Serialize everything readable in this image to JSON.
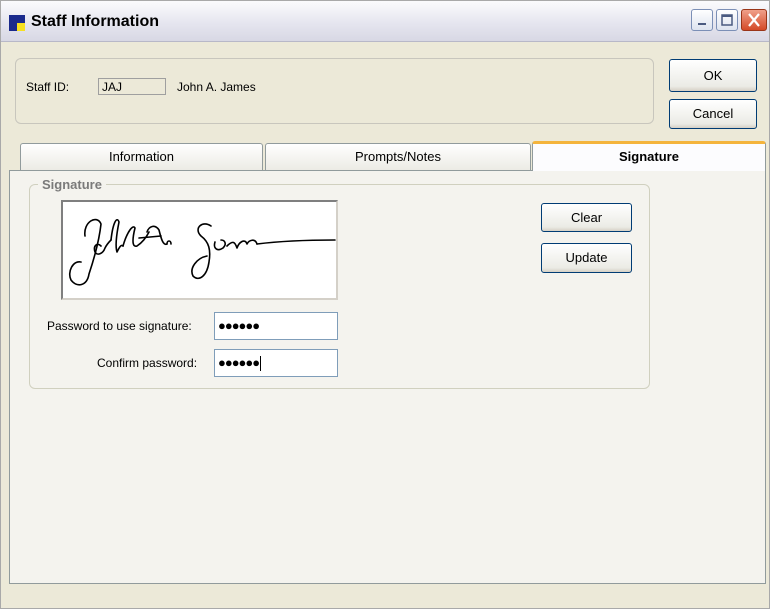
{
  "window": {
    "title": "Staff Information"
  },
  "header": {
    "staff_id_label": "Staff ID:",
    "staff_id_value": "JAJ",
    "staff_name": "John A. James"
  },
  "buttons": {
    "ok": "OK",
    "cancel": "Cancel",
    "clear": "Clear",
    "update": "Update"
  },
  "tabs": [
    {
      "label": "Information",
      "selected": false
    },
    {
      "label": "Prompts/Notes",
      "selected": false
    },
    {
      "label": "Signature",
      "selected": true
    }
  ],
  "signature_group": {
    "legend": "Signature",
    "password_label": "Password to use signature:",
    "password_value": "●●●●●●",
    "confirm_label": "Confirm password:",
    "confirm_value": "●●●●●●"
  },
  "colors": {
    "active_tab_accent": "#f4b43c",
    "close_button": "#d44a28",
    "title_icon_blue": "#1a2a8c",
    "title_icon_yellow": "#f6e020"
  }
}
